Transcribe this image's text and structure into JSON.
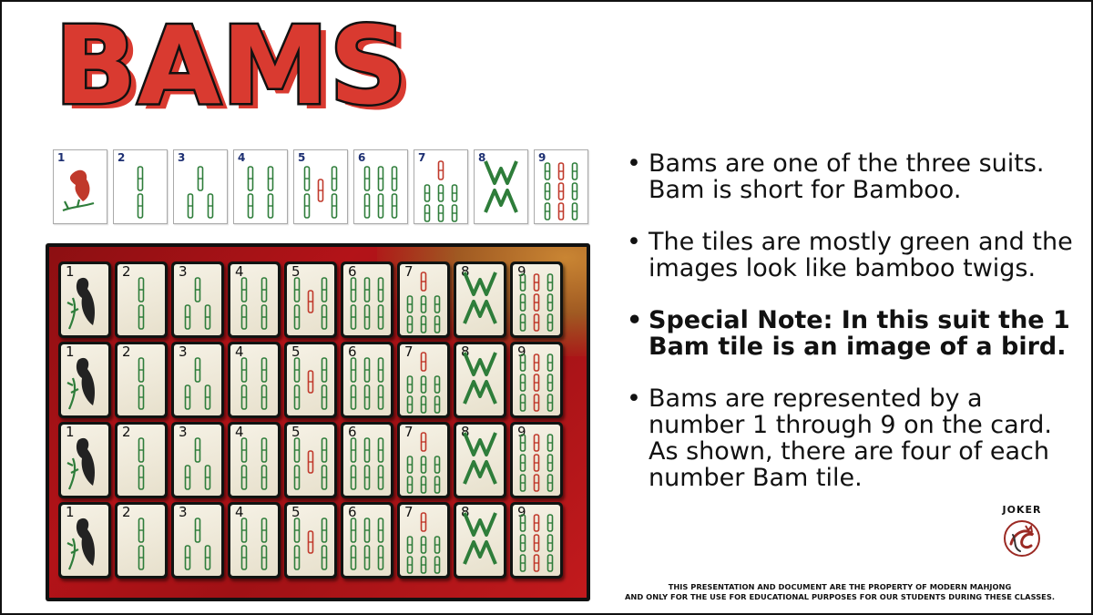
{
  "title": "BAMS",
  "tile_strip": [
    "1",
    "2",
    "3",
    "4",
    "5",
    "6",
    "7",
    "8",
    "9"
  ],
  "photo_tiles": {
    "rows": [
      [
        "1",
        "2",
        "3",
        "4",
        "5",
        "6",
        "7",
        "8",
        "9"
      ],
      [
        "1",
        "2",
        "3",
        "4",
        "5",
        "6",
        "7",
        "8",
        "9"
      ],
      [
        "1",
        "2",
        "3",
        "4",
        "5",
        "6",
        "7",
        "8",
        "9"
      ],
      [
        "1",
        "2",
        "3",
        "4",
        "5",
        "6",
        "7",
        "8",
        "9"
      ]
    ]
  },
  "bullets": [
    {
      "text": "Bams are one of the three suits. Bam is short for Bamboo.",
      "bold": false
    },
    {
      "text": "The tiles are mostly green and the images look like bamboo twigs.",
      "bold": false
    },
    {
      "text": "Special Note: In this suit the 1 Bam tile is an image of a bird.",
      "bold": true
    },
    {
      "text": "Bams are represented by a number 1 through 9 on the card. As shown, there are four of each number Bam tile.",
      "bold": false
    }
  ],
  "bullet_marker": "•",
  "logo": {
    "text": "JOKER"
  },
  "footer": {
    "line1": "THIS PRESENTATION AND DOCUMENT ARE THE PROPERTY OF MODERN MAHJONG",
    "line2": "AND ONLY FOR THE USE FOR EDUCATIONAL PURPOSES FOR OUR STUDENTS DURING THESE CLASSES."
  },
  "colors": {
    "title_red": "#d93a30",
    "bamboo_green": "#2e7d3a",
    "bamboo_red": "#c0392b",
    "felt_red": "#b31318",
    "tile_number_blue": "#1d2f72"
  }
}
